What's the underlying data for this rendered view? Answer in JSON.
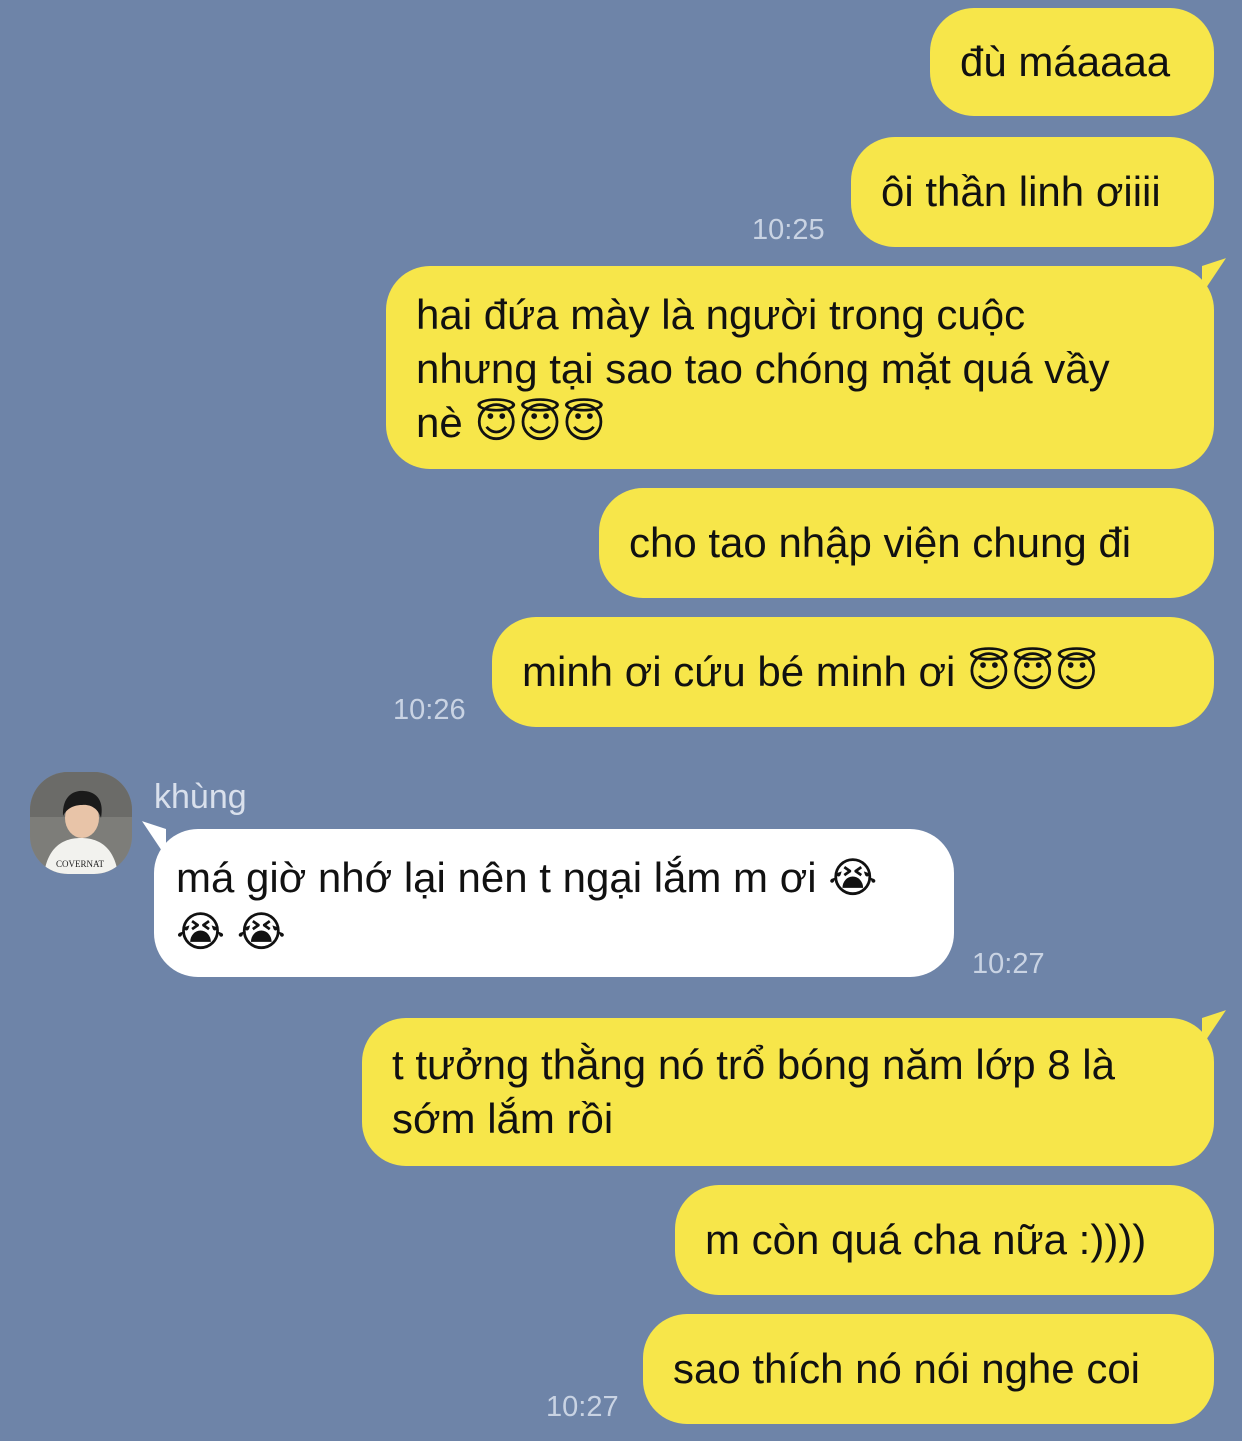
{
  "messages": [
    {
      "text": "đù máaaaa"
    },
    {
      "text": "ôi thần linh ơiiii"
    },
    {
      "lines": [
        "hai đứa mày là người trong cuộc",
        "nhưng tại sao tao chóng mặt quá vầy",
        "nè 😇😇😇"
      ]
    },
    {
      "text": "cho tao nhập viện chung đi"
    },
    {
      "text": "minh ơi cứu bé minh ơi 😇😇😇"
    },
    {
      "lines": [
        "má giờ nhớ lại nên t ngại lắm m ơi 😭",
        "😭 😭"
      ]
    },
    {
      "lines": [
        "t tưởng thằng nó trổ bóng năm lớp 8 là",
        "sớm lắm rồi"
      ]
    },
    {
      "text": "m còn quá cha nữa :))))"
    },
    {
      "text": "sao thích nó nói nghe coi"
    }
  ],
  "timestamps": {
    "t1": "10:25",
    "t2": "10:26",
    "t3": "10:27",
    "t4": "10:27"
  },
  "contact": {
    "name": "khùng",
    "avatar_shirt_text": "COVERNAT"
  },
  "colors": {
    "background": "#6e84a8",
    "my_bubble": "#f7e64a",
    "their_bubble": "#ffffff",
    "timestamp": "#c9d3e3"
  }
}
